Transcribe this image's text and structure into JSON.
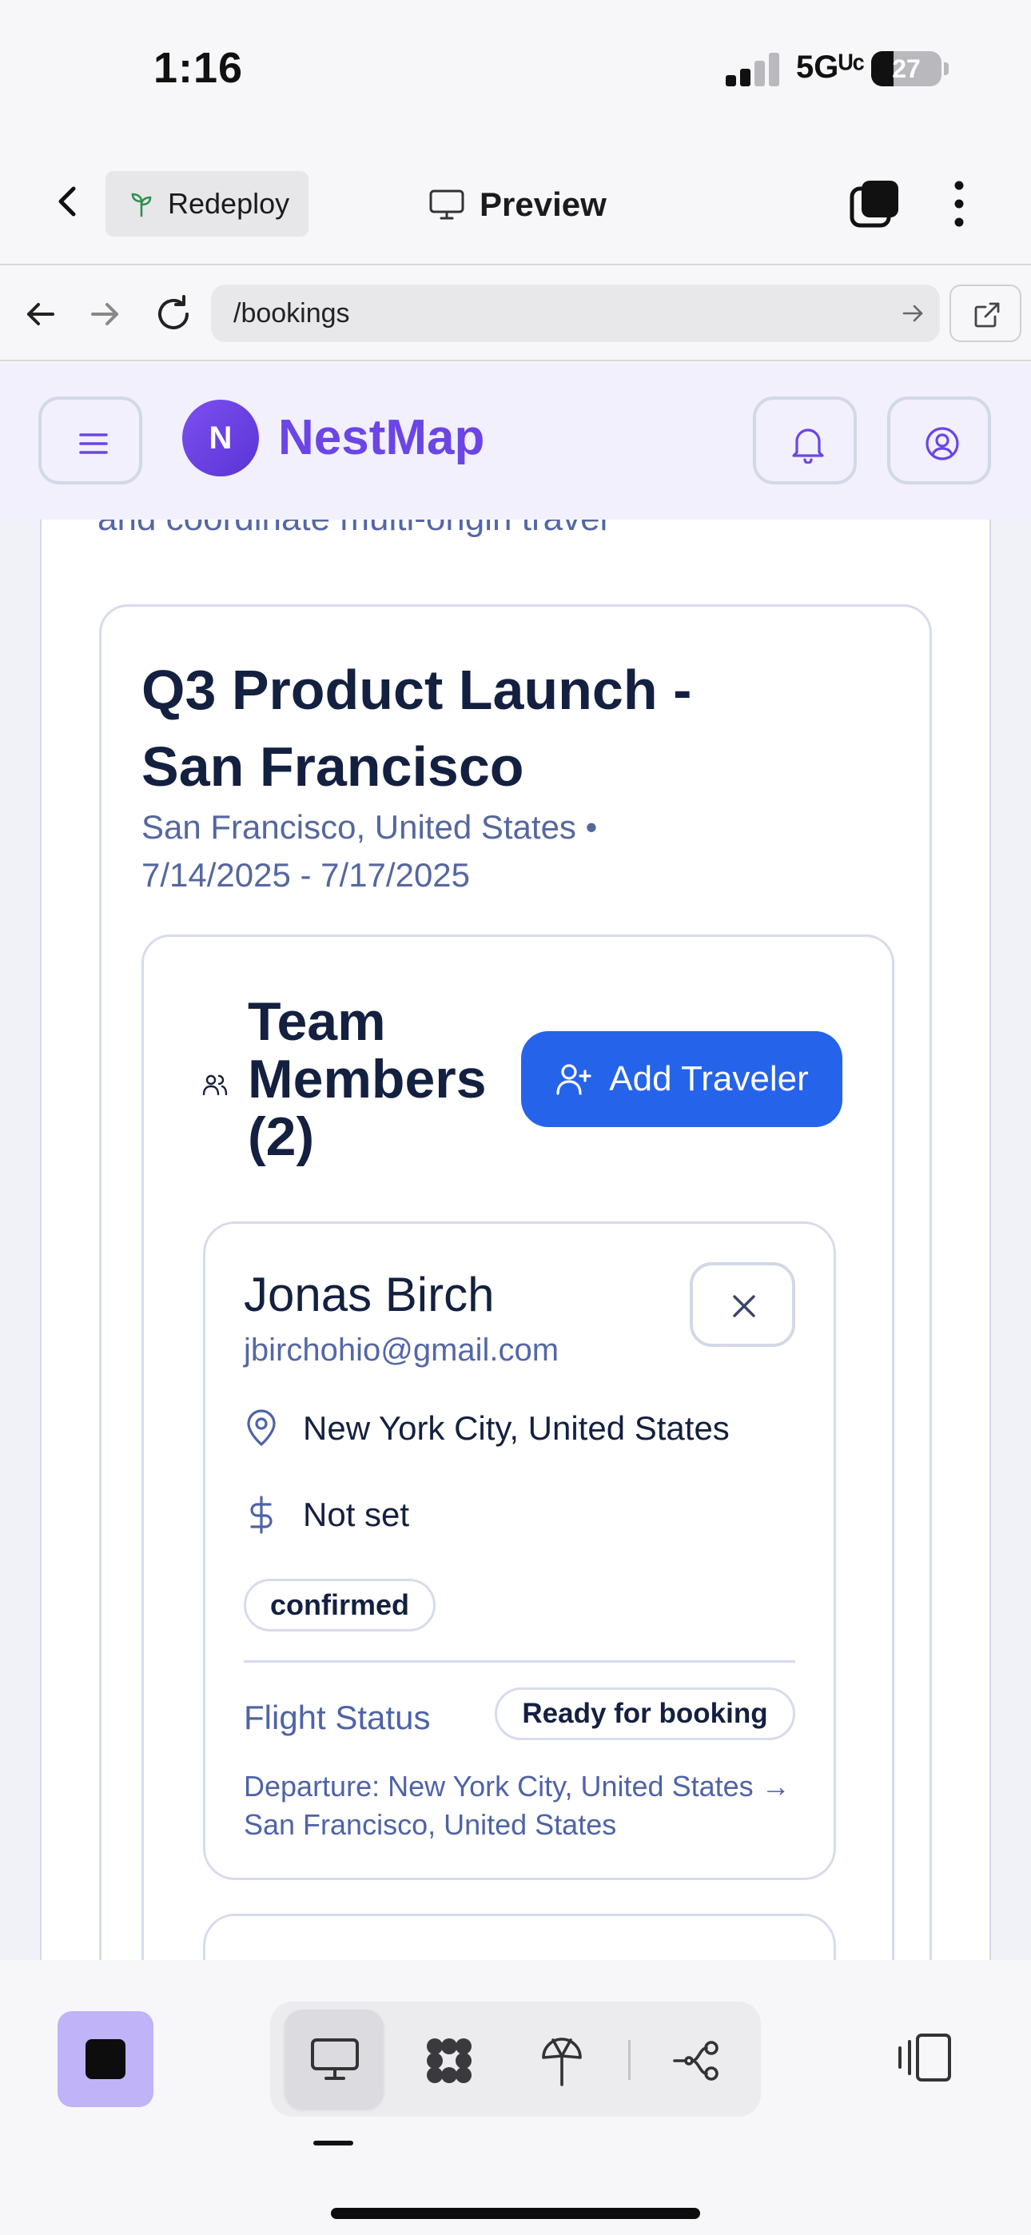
{
  "status_bar": {
    "time": "1:16",
    "network": "5Gᵁᶜ",
    "battery": "27"
  },
  "app_header": {
    "redeploy_label": "Redeploy",
    "preview_label": "Preview"
  },
  "browser": {
    "url": "/bookings"
  },
  "site": {
    "logo_initial": "N",
    "brand": "NestMap"
  },
  "page": {
    "intro_text": "and coordinate multi-origin travel",
    "trip": {
      "title": "Q3 Product Launch - San Francisco",
      "location": "San Francisco, United States •",
      "dates": "7/14/2025 - 7/17/2025"
    },
    "team": {
      "heading": "Team Members (2)",
      "add_button": "Add Traveler"
    },
    "members": [
      {
        "name": "Jonas Birch",
        "email": "jbirchohio@gmail.com",
        "origin": "New York City, United States",
        "budget": "Not set",
        "status": "confirmed",
        "flight_status_label": "Flight Status",
        "flight_status": "Ready for booking",
        "departure": "Departure: New York City, United States → San Francisco, United States"
      }
    ]
  },
  "icons": {
    "back": "chevron-left-icon",
    "redeploy": "sprout-icon",
    "preview": "monitor-icon",
    "tabs": "tabs-icon",
    "more": "more-vertical-icon",
    "menu": "hamburger-icon",
    "bell": "bell-icon",
    "profile": "user-circle-icon",
    "team": "users-icon",
    "add_traveler": "user-plus-icon",
    "remove": "close-icon",
    "location": "map-pin-icon",
    "budget": "dollar-icon"
  },
  "colors": {
    "brand": "#6b45e6",
    "primary_button": "#2563eb",
    "muted_text": "#5467a6",
    "heading_text": "#142040",
    "stop_button": "#c0b3f7"
  }
}
